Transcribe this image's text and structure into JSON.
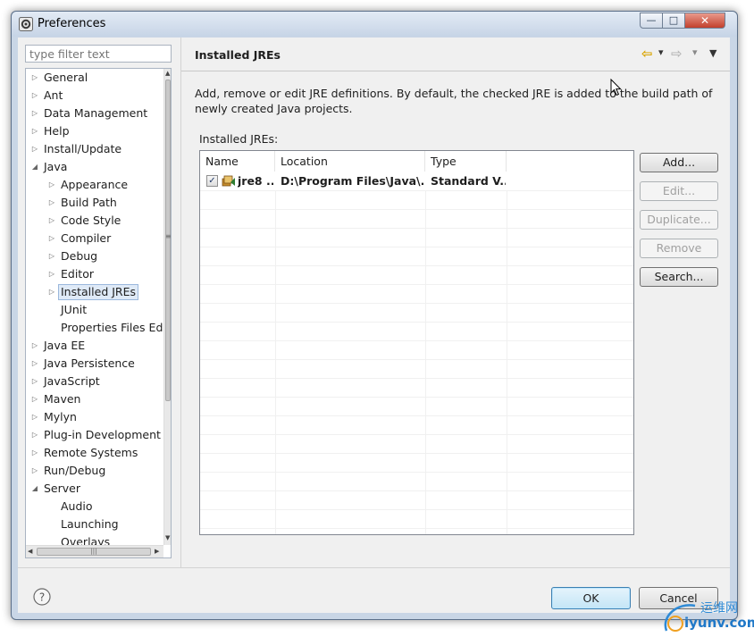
{
  "window": {
    "title": "Preferences",
    "controls": {
      "minimize": "—",
      "maximize": "□",
      "close": "✕"
    }
  },
  "sidebar": {
    "filter_placeholder": "type filter text",
    "items": [
      {
        "label": "General",
        "level": 0,
        "expander": "▷"
      },
      {
        "label": "Ant",
        "level": 0,
        "expander": "▷"
      },
      {
        "label": "Data Management",
        "level": 0,
        "expander": "▷"
      },
      {
        "label": "Help",
        "level": 0,
        "expander": "▷"
      },
      {
        "label": "Install/Update",
        "level": 0,
        "expander": "▷"
      },
      {
        "label": "Java",
        "level": 0,
        "expander": "◢"
      },
      {
        "label": "Appearance",
        "level": 1,
        "expander": "▷"
      },
      {
        "label": "Build Path",
        "level": 1,
        "expander": "▷"
      },
      {
        "label": "Code Style",
        "level": 1,
        "expander": "▷"
      },
      {
        "label": "Compiler",
        "level": 1,
        "expander": "▷"
      },
      {
        "label": "Debug",
        "level": 1,
        "expander": "▷"
      },
      {
        "label": "Editor",
        "level": 1,
        "expander": "▷"
      },
      {
        "label": "Installed JREs",
        "level": 1,
        "expander": "▷",
        "selected": true
      },
      {
        "label": "JUnit",
        "level": 1,
        "expander": ""
      },
      {
        "label": "Properties Files Ed",
        "level": 1,
        "expander": ""
      },
      {
        "label": "Java EE",
        "level": 0,
        "expander": "▷"
      },
      {
        "label": "Java Persistence",
        "level": 0,
        "expander": "▷"
      },
      {
        "label": "JavaScript",
        "level": 0,
        "expander": "▷"
      },
      {
        "label": "Maven",
        "level": 0,
        "expander": "▷"
      },
      {
        "label": "Mylyn",
        "level": 0,
        "expander": "▷"
      },
      {
        "label": "Plug-in Development",
        "level": 0,
        "expander": "▷"
      },
      {
        "label": "Remote Systems",
        "level": 0,
        "expander": "▷"
      },
      {
        "label": "Run/Debug",
        "level": 0,
        "expander": "▷"
      },
      {
        "label": "Server",
        "level": 0,
        "expander": "◢"
      },
      {
        "label": "Audio",
        "level": 1,
        "expander": ""
      },
      {
        "label": "Launching",
        "level": 1,
        "expander": ""
      },
      {
        "label": "Overlays",
        "level": 1,
        "expander": ""
      }
    ],
    "scroll_up": "▲",
    "scroll_down": "▼",
    "scroll_left": "◀",
    "scroll_right": "▶",
    "grip": "≡",
    "hgrip": "|||"
  },
  "page": {
    "title": "Installed JREs",
    "nav_back": "⇦",
    "nav_forward": "⇨",
    "dropdown": "▾",
    "menu": "▼",
    "description": "Add, remove or edit JRE definitions. By default, the checked JRE is added to the build path of newly created Java projects.",
    "table_label": "Installed JREs:",
    "columns": [
      "Name",
      "Location",
      "Type"
    ],
    "rows": [
      {
        "checked": true,
        "check_mark": "✓",
        "name": "jre8 ...",
        "location": "D:\\Program Files\\Java\\...",
        "type": "Standard V..."
      }
    ],
    "buttons": {
      "add": "Add...",
      "edit": "Edit...",
      "duplicate": "Duplicate...",
      "remove": "Remove",
      "search": "Search..."
    }
  },
  "footer": {
    "help_icon": "?",
    "ok": "OK",
    "cancel": "Cancel"
  },
  "watermark": {
    "text": "运维网",
    "url": "iyunv.com"
  },
  "colors": {
    "accent": "#3c7fb1",
    "selection": "#dfeaf7",
    "frame": "#c9d6e6"
  }
}
